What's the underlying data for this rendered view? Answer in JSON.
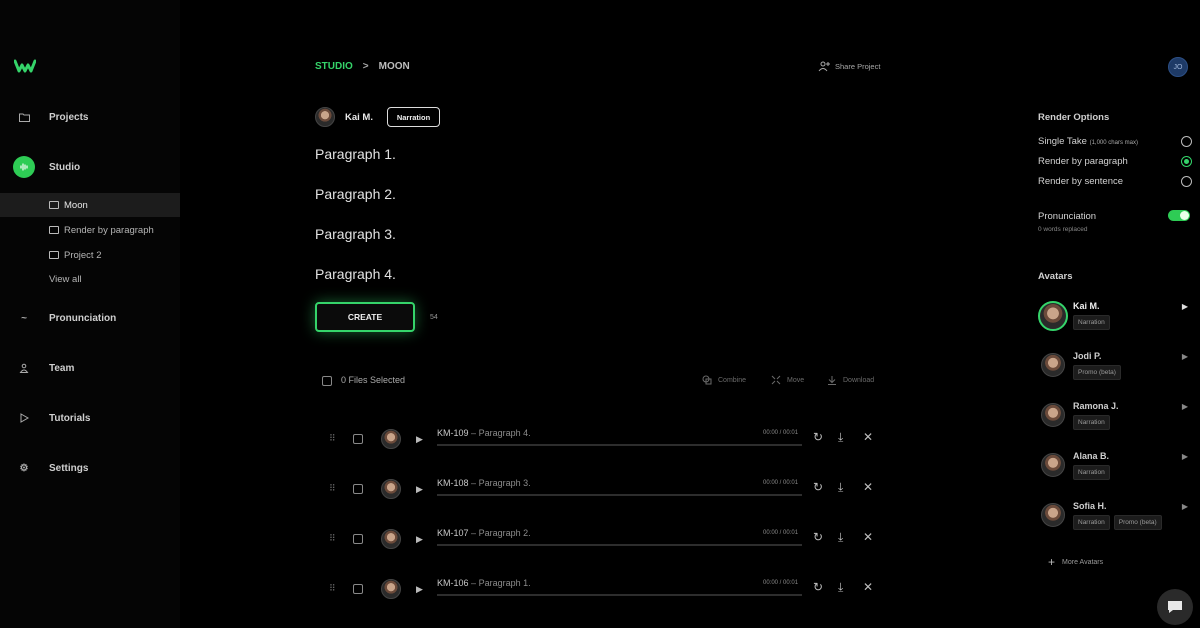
{
  "brand": {
    "accent": "#35d46a",
    "logo_icon": "w-logo-icon"
  },
  "sidebar": {
    "items": [
      {
        "label": "Projects",
        "icon": "folder-icon"
      },
      {
        "label": "Studio",
        "icon": "waveform-icon"
      },
      {
        "label": "Pronunciation",
        "icon": "tilde-icon"
      },
      {
        "label": "Team",
        "icon": "person-icon"
      },
      {
        "label": "Tutorials",
        "icon": "play-icon"
      },
      {
        "label": "Settings",
        "icon": "gear-icon"
      }
    ],
    "sub_items": [
      {
        "label": "Moon",
        "active": true
      },
      {
        "label": "Render by paragraph",
        "active": false
      },
      {
        "label": "Project 2",
        "active": false
      }
    ],
    "view_all": "View all"
  },
  "header": {
    "breadcrumb": [
      "STUDIO",
      ">",
      "MOON"
    ],
    "share_label": "Share Project",
    "user_initials": "JO"
  },
  "editor": {
    "speaker_name": "Kai M.",
    "style_label": "Narration",
    "paragraphs": [
      "Paragraph 1.",
      "Paragraph 2.",
      "Paragraph 3.",
      "Paragraph 4."
    ],
    "create_label": "CREATE",
    "char_count": "54"
  },
  "files": {
    "selected_label": "0 Files Selected",
    "tools": [
      {
        "label": "Combine",
        "icon": "combine-icon"
      },
      {
        "label": "Move",
        "icon": "move-icon"
      },
      {
        "label": "Download",
        "icon": "download-icon"
      }
    ],
    "rows": [
      {
        "id": "KM-109",
        "separator": "–",
        "name": "Paragraph 4.",
        "time": "00:00 / 00:01"
      },
      {
        "id": "KM-108",
        "separator": "–",
        "name": "Paragraph 3.",
        "time": "00:00 / 00:01"
      },
      {
        "id": "KM-107",
        "separator": "–",
        "name": "Paragraph 2.",
        "time": "00:00 / 00:01"
      },
      {
        "id": "KM-106",
        "separator": "–",
        "name": "Paragraph 1.",
        "time": "00:00 / 00:01"
      }
    ]
  },
  "render_options": {
    "heading": "Render Options",
    "options": [
      {
        "label": "Single Take",
        "note": "(1,000 chars max)",
        "selected": false
      },
      {
        "label": "Render by paragraph",
        "note": "",
        "selected": true
      },
      {
        "label": "Render by sentence",
        "note": "",
        "selected": false
      }
    ],
    "pronunciation_label": "Pronunciation",
    "pronunciation_on": true,
    "pronunciation_sub": "0 words replaced"
  },
  "avatars": {
    "heading": "Avatars",
    "list": [
      {
        "name": "Kai M.",
        "tags": [
          "Narration"
        ],
        "selected": true
      },
      {
        "name": "Jodi P.",
        "tags": [
          "Promo (beta)"
        ],
        "selected": false
      },
      {
        "name": "Ramona J.",
        "tags": [
          "Narration"
        ],
        "selected": false
      },
      {
        "name": "Alana B.",
        "tags": [
          "Narration"
        ],
        "selected": false
      },
      {
        "name": "Sofia H.",
        "tags": [
          "Narration",
          "Promo (beta)"
        ],
        "selected": false
      }
    ],
    "more_label": "More Avatars"
  }
}
